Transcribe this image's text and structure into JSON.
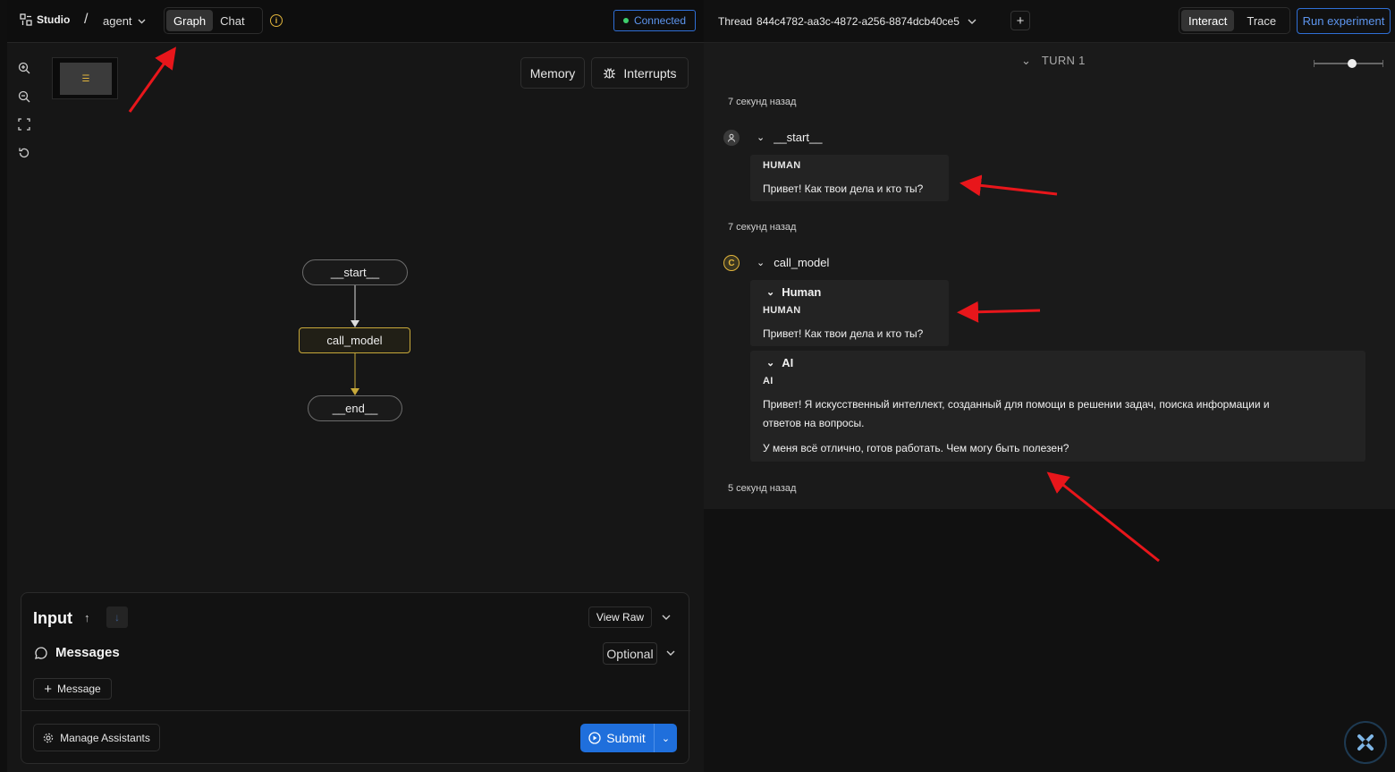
{
  "header": {
    "app_name": "Studio",
    "separator": "/",
    "graph_name": "agent",
    "tabs": [
      "Graph",
      "Chat"
    ],
    "status": "Connected"
  },
  "graph_panel": {
    "buttons": {
      "memory": "Memory",
      "interrupts": "Interrupts"
    },
    "nodes": [
      "__start__",
      "call_model",
      "__end__"
    ]
  },
  "input_panel": {
    "title": "Input",
    "view_raw": "View Raw",
    "messages_label": "Messages",
    "optional": "Optional",
    "add_message": "Message",
    "manage_assistants": "Manage Assistants",
    "submit": "Submit"
  },
  "thread_panel": {
    "thread_label": "Thread",
    "thread_id": "844c4782-aa3c-4872-a256-8874dcb40ce5",
    "tabs": [
      "Interact",
      "Trace"
    ],
    "run_experiment": "Run experiment",
    "turn": "TURN 1",
    "entries": [
      {
        "timestamp": "7 секунд назад",
        "node": "__start__",
        "avatar": "person-icon",
        "role": "HUMAN",
        "text": "Привет! Как твои дела и кто ты?"
      },
      {
        "timestamp": "7 секунд назад",
        "node": "call_model",
        "avatar": "C",
        "human_section": "Human",
        "human_role": "HUMAN",
        "human_text": "Привет! Как твои дела и кто ты?",
        "ai_section": "AI",
        "ai_role": "AI",
        "ai_text_1": "Привет! Я искусственный интеллект, созданный для помощи в решении задач, поиска информации и",
        "ai_text_2": "ответов на вопросы.",
        "ai_text_3": "У меня всё отлично, готов работать. Чем могу быть полезен?"
      }
    ],
    "last_timestamp": "5 секунд назад"
  },
  "colors": {
    "accent": "#1f6fdc",
    "node_highlight": "#c8a93a",
    "annotation_arrow": "#e8161b"
  }
}
